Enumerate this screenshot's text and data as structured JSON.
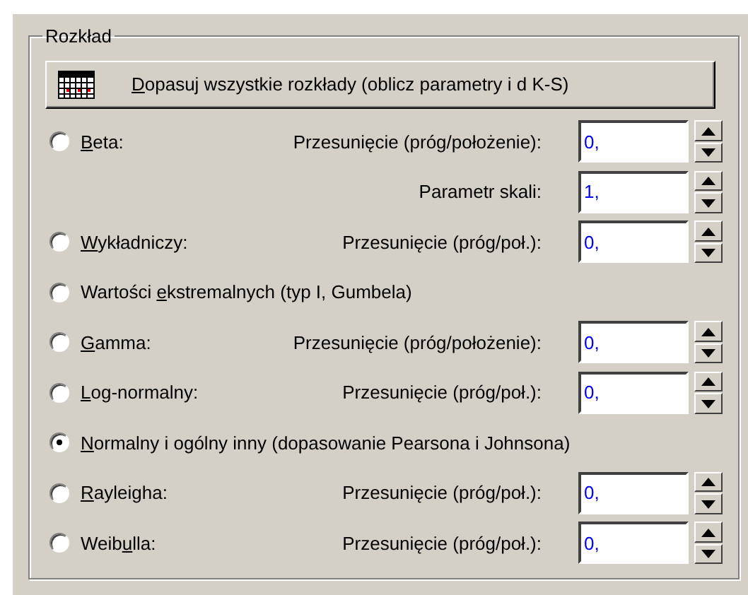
{
  "group": {
    "title": "Rozkład"
  },
  "fit_button": {
    "key": "D",
    "post": "opasuj wszystkie rozkłady (oblicz parametry i d K-S)"
  },
  "rows": [
    {
      "kind": "radio",
      "selected": false,
      "label": {
        "key": "B",
        "post": "eta:"
      },
      "field_label": "Przesunięcie (próg/położenie):",
      "value": "0,"
    },
    {
      "kind": "param",
      "field_label": "Parametr skali:",
      "value": "1,"
    },
    {
      "kind": "radio",
      "selected": false,
      "label": {
        "key": "W",
        "post": "ykładniczy:"
      },
      "field_label": "Przesunięcie (próg/poł.):",
      "value": "0,"
    },
    {
      "kind": "radio",
      "selected": false,
      "label": {
        "pre": "Wartości ",
        "key": "e",
        "post": "kstremalnych (typ I, Gumbela)"
      }
    },
    {
      "kind": "radio",
      "selected": false,
      "label": {
        "key": "G",
        "post": "amma:"
      },
      "field_label": "Przesunięcie (próg/położenie):",
      "value": "0,"
    },
    {
      "kind": "radio",
      "selected": false,
      "label": {
        "key": "L",
        "post": "og-normalny:"
      },
      "field_label": "Przesunięcie (próg/poł.):",
      "value": "0,"
    },
    {
      "kind": "radio",
      "selected": true,
      "label": {
        "key": "N",
        "post": "ormalny i ogólny inny (dopasowanie Pearsona i Johnsona)"
      }
    },
    {
      "kind": "radio",
      "selected": false,
      "label": {
        "key": "R",
        "post": "ayleigha:"
      },
      "field_label": "Przesunięcie (próg/poł.):",
      "value": "0,"
    },
    {
      "kind": "radio",
      "selected": false,
      "label": {
        "pre": "Weib",
        "key": "u",
        "post": "lla:"
      },
      "field_label": "Przesunięcie (próg/poł.):",
      "value": "0,"
    }
  ]
}
